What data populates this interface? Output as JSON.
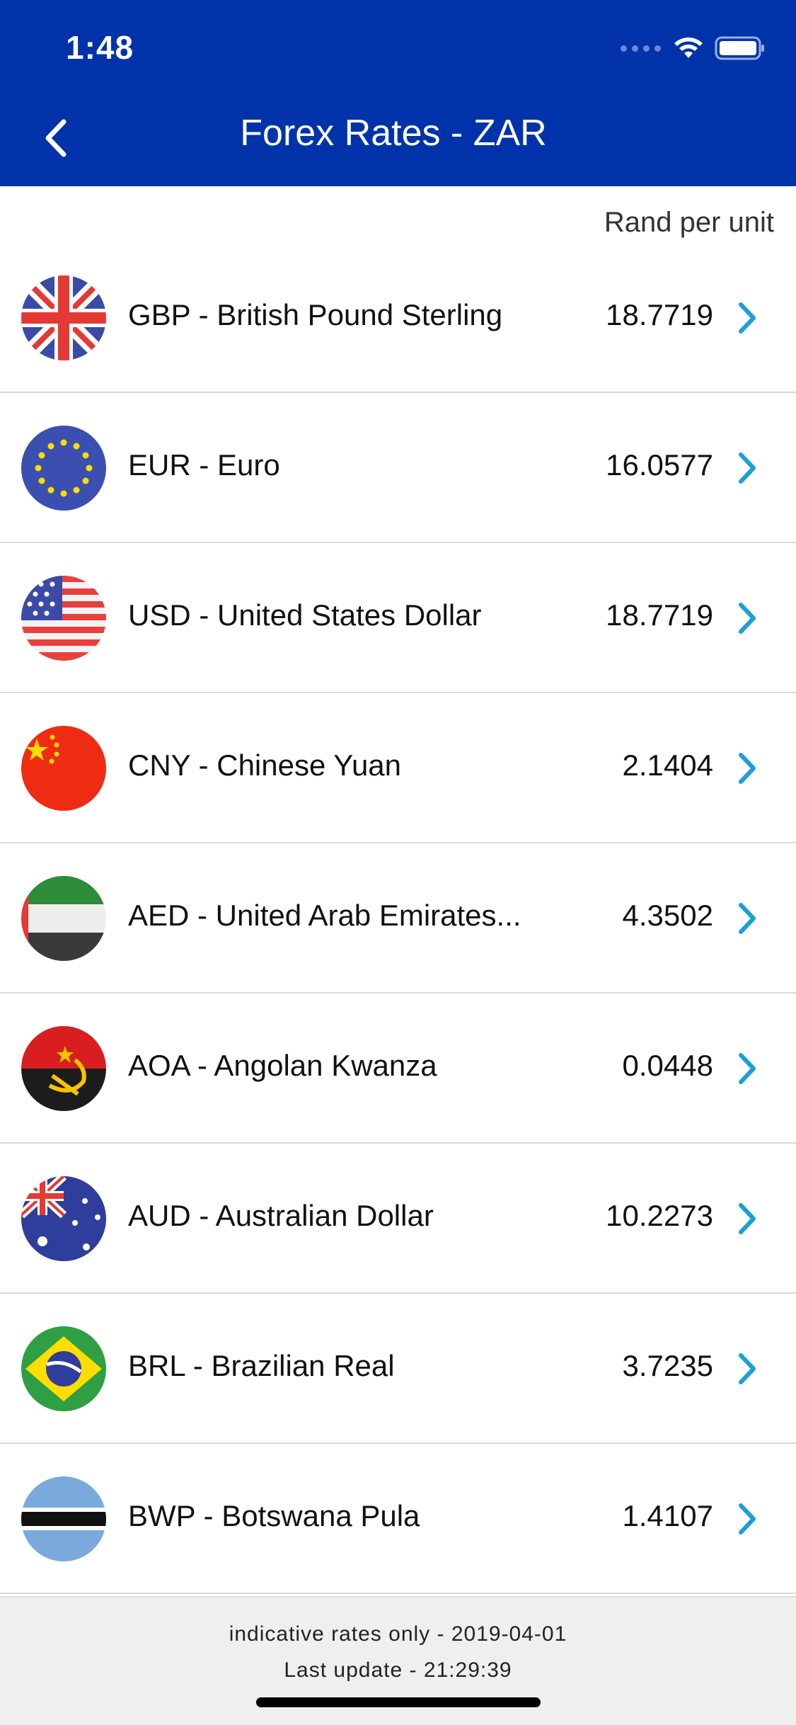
{
  "status_bar": {
    "time": "1:48"
  },
  "nav": {
    "title": "Forex Rates - ZAR"
  },
  "unit_label": "Rand per unit",
  "colors": {
    "header": "#0033aa",
    "chevron": "#1a9fd9",
    "footer": "#efefef"
  },
  "rates": [
    {
      "code_name": "GBP - British Pound Sterling",
      "value": "18.7719",
      "flag": "uk-flag-icon"
    },
    {
      "code_name": "EUR - Euro",
      "value": "16.0577",
      "flag": "eu-flag-icon"
    },
    {
      "code_name": "USD - United States Dollar",
      "value": "18.7719",
      "flag": "us-flag-icon"
    },
    {
      "code_name": "CNY - Chinese Yuan",
      "value": "2.1404",
      "flag": "china-flag-icon"
    },
    {
      "code_name": "AED - United Arab Emirates...",
      "value": "4.3502",
      "flag": "uae-flag-icon"
    },
    {
      "code_name": "AOA - Angolan Kwanza",
      "value": "0.0448",
      "flag": "angola-flag-icon"
    },
    {
      "code_name": "AUD - Australian Dollar",
      "value": "10.2273",
      "flag": "australia-flag-icon"
    },
    {
      "code_name": "BRL - Brazilian Real",
      "value": "3.7235",
      "flag": "brazil-flag-icon"
    },
    {
      "code_name": "BWP - Botswana Pula",
      "value": "1.4107",
      "flag": "botswana-flag-icon"
    }
  ],
  "footer": {
    "line1": "indicative rates only - 2019-04-01",
    "line2": "Last update - 21:29:39"
  }
}
